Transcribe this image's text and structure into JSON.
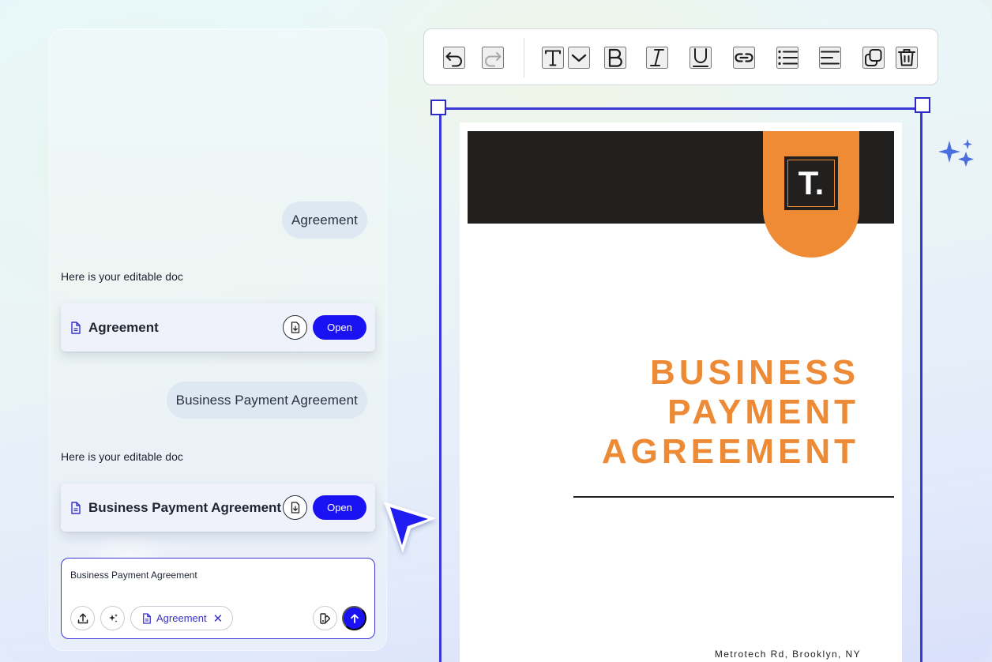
{
  "chat": {
    "messages": [
      {
        "role": "user",
        "text": "Agreement"
      },
      {
        "role": "assistant",
        "text": "Here is your editable doc"
      },
      {
        "role": "user",
        "text": "Business Payment Agreement"
      },
      {
        "role": "assistant",
        "text": "Here is your editable doc"
      }
    ],
    "doc_cards": [
      {
        "title": "Agreement",
        "open_label": "Open",
        "icon": "document-icon",
        "download_icon": "download-icon"
      },
      {
        "title": "Business Payment Agreement",
        "open_label": "Open",
        "icon": "document-icon",
        "download_icon": "download-icon"
      }
    ],
    "composer": {
      "value": "Business Payment Agreement",
      "attachment_chip": "Agreement",
      "upload_icon": "upload-icon",
      "magic_icon": "sparkle-icon",
      "layout_icon": "layout-icon",
      "send_icon": "arrow-up-icon"
    }
  },
  "toolbar": {
    "tools": [
      "undo-icon",
      "redo-icon",
      "text-icon",
      "chevron-down-icon",
      "bold-icon",
      "italic-icon",
      "underline-icon",
      "link-icon",
      "bullet-list-icon",
      "align-left-icon",
      "duplicate-icon",
      "trash-icon"
    ]
  },
  "document": {
    "logo_text": "T.",
    "heading_lines": [
      "BUSINESS",
      "PAYMENT",
      "AGREEMENT"
    ],
    "address": "Metrotech Rd, Brooklyn, NY"
  },
  "colors": {
    "accent_blue": "#1a12f2",
    "selection_blue": "#3a38d6",
    "doc_orange": "#ef8b35",
    "doc_dark": "#221f1f"
  }
}
